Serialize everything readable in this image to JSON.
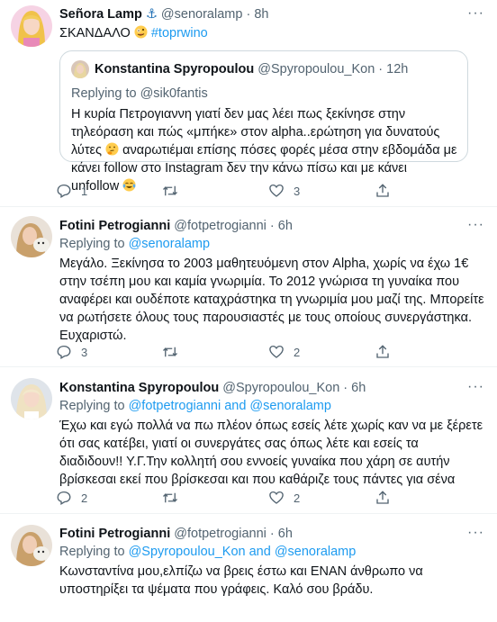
{
  "tweets": [
    {
      "name": "Señora Lamp",
      "name_suffix": "⚓",
      "handle": "@senoralamp",
      "time": "8h",
      "text_main": "ΣΚΑΝΔΑΛΟ",
      "hashtag": "#toprwino",
      "quote": {
        "name": "Konstantina Spyropoulou",
        "handle": "@Spyropoulou_Kon",
        "time": "12h",
        "replying_prefix": "Replying to",
        "replying_to": "@sik0fantis",
        "text_1": "Η κυρία Πετρογιαννη γιατί δεν μας λέει πως ξεκίνησε στην τηλεόραση και πώς «μπήκε» στον alpha..ερώτηση για δυνατούς λύτες",
        "text_2": "αναρωτιέμαι επίσης πόσες φορές μέσα στην εβδομάδα με κάνει follow στο Instagram δεν την κάνω πίσω και με κάνει unfollow"
      },
      "replies": "1",
      "retweets": "",
      "likes": "3"
    },
    {
      "name": "Fotini Petrogianni",
      "handle": "@fotpetrogianni",
      "time": "6h",
      "replying_prefix": "Replying to",
      "replying_to": "@senoralamp",
      "text": "Μεγάλο. Ξεκίνησα το 2003 μαθητευόμενη στον Alpha, χωρίς να έχω 1€ στην τσέπη μου και καμία γνωριμία. Το 2012 γνώρισα τη γυναίκα που αναφέρει και ουδέποτε καταχράστηκα τη γνωριμία μου μαζί της. Μπορείτε να ρωτήσετε όλους τους παρουσιαστές με τους οποίους συνεργάστηκα. Ευχαριστώ.",
      "replies": "3",
      "retweets": "",
      "likes": "2"
    },
    {
      "name": "Konstantina Spyropoulou",
      "handle": "@Spyropoulou_Kon",
      "time": "6h",
      "replying_prefix": "Replying to",
      "replying_to": "@fotpetrogianni and @senoralamp",
      "text": "Έχω και εγώ πολλά να πω πλέον όπως εσείς λέτε χωρίς καν να με ξέρετε ότι σας κατέβει, γιατί οι συνεργάτες σας όπως λέτε και εσείς τα διαδιδουν!! Υ.Γ.Την κολλητή σου εννοείς γυναίκα που χάρη σε αυτήν βρίσκεσαι εκεί που βρίσκεσαι και που καθάριζε τους πάντες για σένα",
      "replies": "2",
      "retweets": "",
      "likes": "2"
    },
    {
      "name": "Fotini Petrogianni",
      "handle": "@fotpetrogianni",
      "time": "6h",
      "replying_prefix": "Replying to",
      "replying_to": "@Spyropoulou_Kon and @senoralamp",
      "text": "Κωνσταντίνα μου,ελπίζω να βρεις έστω και ΕΝΑΝ άνθρωπο να υποστηρίξει τα ψέματα που γράφεις. Καλό σου βράδυ."
    }
  ],
  "separator": "·",
  "more_glyph": "···",
  "icons": [
    "reply-icon",
    "retweet-icon",
    "like-icon",
    "share-icon",
    "more-icon"
  ],
  "colors": {
    "link": "#1d9bf0",
    "muted": "#536471",
    "text": "#0f1419",
    "border": "#cfd9de"
  }
}
